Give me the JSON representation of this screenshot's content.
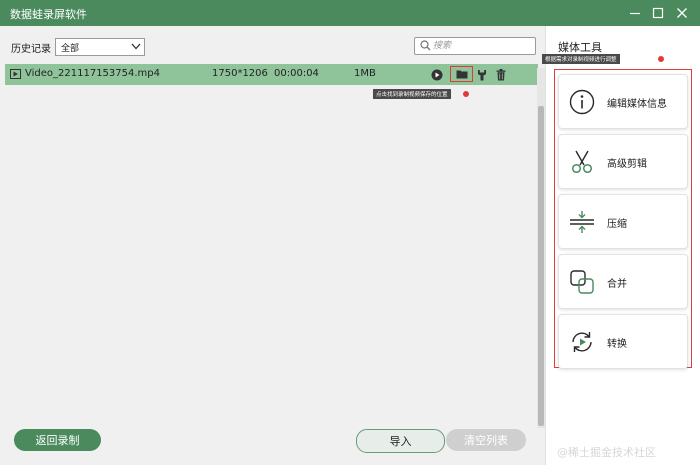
{
  "app": {
    "title": "数据蛙录屏软件"
  },
  "window_controls": {
    "minimize_icon": "minimize-icon",
    "maximize_icon": "maximize-icon",
    "close_icon": "close-icon"
  },
  "toolbar": {
    "history_label": "历史记录",
    "history_filter": {
      "selected": "全部"
    },
    "search": {
      "placeholder": "搜索"
    }
  },
  "recordings": [
    {
      "name": "Video_221117153754.mp4",
      "resolution": "1750*1206",
      "duration": "00:00:04",
      "size": "1MB"
    }
  ],
  "tooltips": {
    "folder": "点击找到录制视频保存的位置",
    "media_tools": "根据需求对录制视频进行调整"
  },
  "sidebar": {
    "title": "媒体工具",
    "tools": [
      {
        "label": "编辑媒体信息",
        "icon": "info-icon"
      },
      {
        "label": "高级剪辑",
        "icon": "scissors-icon"
      },
      {
        "label": "压缩",
        "icon": "compress-icon"
      },
      {
        "label": "合并",
        "icon": "merge-icon"
      },
      {
        "label": "转换",
        "icon": "convert-icon"
      }
    ]
  },
  "buttons": {
    "back": "返回录制",
    "import": "导入",
    "clear": "清空列表"
  },
  "watermark": "@稀土掘金技术社区",
  "colors": {
    "accent": "#4a8a5d",
    "row_selected": "#8fc49b",
    "highlight": "#e03b3b"
  }
}
